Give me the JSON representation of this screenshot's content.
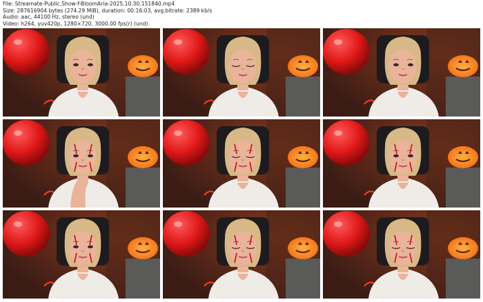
{
  "info": {
    "file": "File: Streamate-Public.Show-f-BloomAria-2025.10.30.151840.mp4",
    "size": "Size: 287616904 bytes (274.29 MiB), duration: 00:16:03, avg.bitrate: 2389 kb/s",
    "audio": "Audio: aac, 44100 Hz, stereo (und)",
    "video": "Video: h264, yuv420p, 1280×720, 3000.00 fps(r) (und)"
  },
  "thumbnails": [
    {
      "pose": "front",
      "face_paint": false
    },
    {
      "pose": "eyes-closed",
      "face_paint": false
    },
    {
      "pose": "front",
      "face_paint": false
    },
    {
      "pose": "hand-to-chin",
      "face_paint": true
    },
    {
      "pose": "eyes-closed",
      "face_paint": true
    },
    {
      "pose": "front",
      "face_paint": true
    },
    {
      "pose": "front",
      "face_paint": true
    },
    {
      "pose": "eyes-closed",
      "face_paint": true
    },
    {
      "pose": "eyes-closed",
      "face_paint": true
    }
  ],
  "colors": {
    "balloon": "#e01818",
    "pumpkin": "#f06a14",
    "background": "#3a1c15",
    "shirt": "#efece8",
    "hair": "#d8b886",
    "skin": "#e9b49a"
  }
}
